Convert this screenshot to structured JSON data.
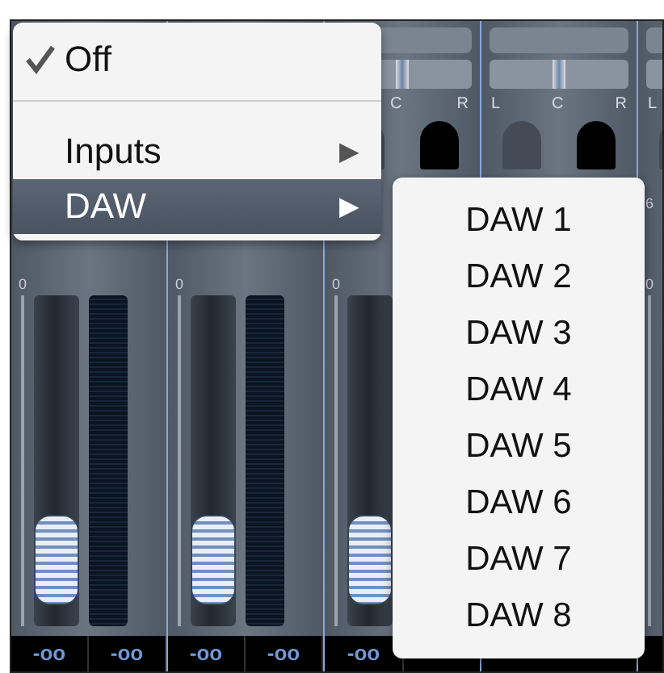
{
  "menu": {
    "items": [
      {
        "kind": "check",
        "label": "Off",
        "checked": true,
        "selected": false
      },
      {
        "kind": "separator"
      },
      {
        "kind": "submenu",
        "label": "Inputs",
        "arrow": "▶",
        "selected": false
      },
      {
        "kind": "submenu",
        "label": "DAW",
        "arrow": "▶",
        "selected": true
      }
    ]
  },
  "submenu": {
    "items": [
      "DAW 1",
      "DAW 2",
      "DAW 3",
      "DAW 4",
      "DAW 5",
      "DAW 6",
      "DAW 7",
      "DAW 8"
    ]
  },
  "strips": [
    {
      "scale_labels": [
        "0"
      ],
      "level": 0.2,
      "readouts": [
        "-oo",
        "-oo"
      ]
    },
    {
      "scale_labels": [
        "0"
      ],
      "level": 0.2,
      "readouts": [
        "-oo",
        "-oo"
      ]
    },
    {
      "pan_labels": [
        "C",
        "R"
      ],
      "pan": {
        "level": 0.5
      },
      "scale_labels": [
        "0"
      ],
      "level": 0.2,
      "readouts": [
        "-oo"
      ]
    },
    {
      "pan_labels": [
        "L",
        "C",
        "R"
      ],
      "pan": {
        "level": 0.5
      }
    },
    {
      "pan_labels": [
        "L"
      ],
      "scale_labels": [
        "6",
        "0"
      ]
    }
  ]
}
